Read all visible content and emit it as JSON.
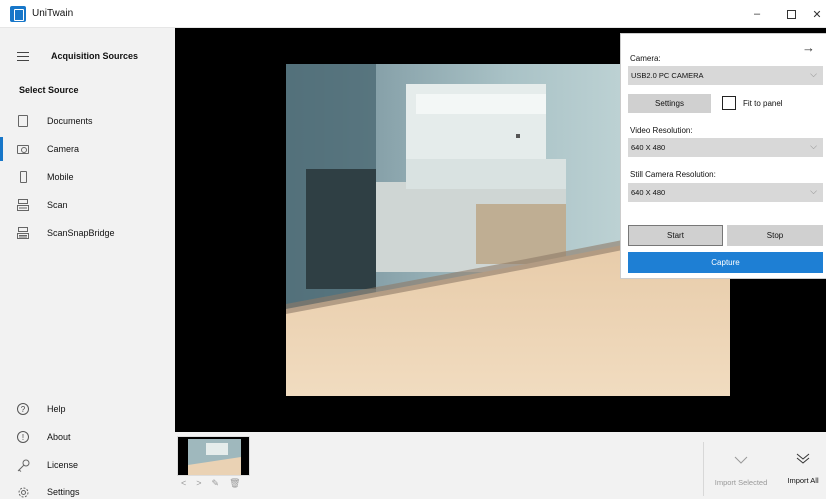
{
  "window": {
    "title": "UniTwain",
    "minimize": "–",
    "close": "✕"
  },
  "sidebar": {
    "header": "Acquisition Sources",
    "select_source": "Select Source",
    "sources": [
      {
        "label": "Documents",
        "icon": "document-icon"
      },
      {
        "label": "Camera",
        "icon": "camera-icon",
        "selected": true
      },
      {
        "label": "Mobile",
        "icon": "mobile-icon"
      },
      {
        "label": "Scan",
        "icon": "scanner-icon"
      },
      {
        "label": "ScanSnapBridge",
        "icon": "scansnap-icon"
      }
    ],
    "bottom": [
      {
        "label": "Help",
        "icon": "help-icon"
      },
      {
        "label": "About",
        "icon": "about-icon"
      },
      {
        "label": "License",
        "icon": "key-icon"
      },
      {
        "label": "Settings",
        "icon": "gear-icon"
      }
    ]
  },
  "camera_panel": {
    "camera_label": "Camera:",
    "camera_value": "USB2.0 PC CAMERA",
    "settings_button": "Settings",
    "fit_to_panel": "Fit to panel",
    "video_resolution_label": "Video Resolution:",
    "video_resolution_value": "640 X 480",
    "still_resolution_label": "Still Camera Resolution:",
    "still_resolution_value": "640 X 480",
    "start_button": "Start",
    "stop_button": "Stop",
    "capture_button": "Capture"
  },
  "import": {
    "selected_label": "Import Selected",
    "all_label": "Import All"
  },
  "colors": {
    "accent": "#1877c9",
    "capture": "#1e7fd4",
    "sidebar_bg": "#f2f2f2",
    "viewer_bg": "#000000"
  }
}
